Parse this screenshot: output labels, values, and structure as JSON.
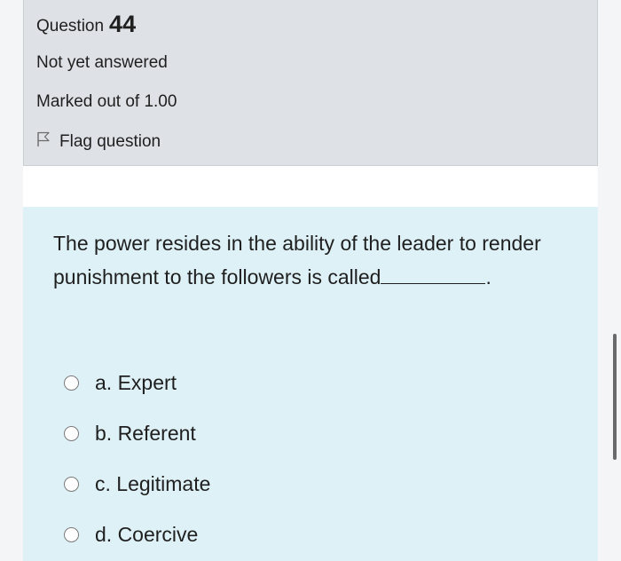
{
  "question": {
    "label": "Question",
    "number": "44",
    "state": "Not yet answered",
    "grade": "Marked out of 1.00",
    "flag_label": "Flag question"
  },
  "content": {
    "text_before": "The power resides in the ability of the leader to render punishment to the followers is called",
    "text_after": ".",
    "answers": [
      {
        "label": "a. Expert"
      },
      {
        "label": "b. Referent"
      },
      {
        "label": "c. Legitimate"
      },
      {
        "label": "d. Coercive"
      }
    ]
  },
  "colors": {
    "info_bg": "#dee2e6",
    "content_bg": "#def1f7"
  },
  "icons": {
    "flag": "flag-icon",
    "radio": "radio-unchecked"
  }
}
